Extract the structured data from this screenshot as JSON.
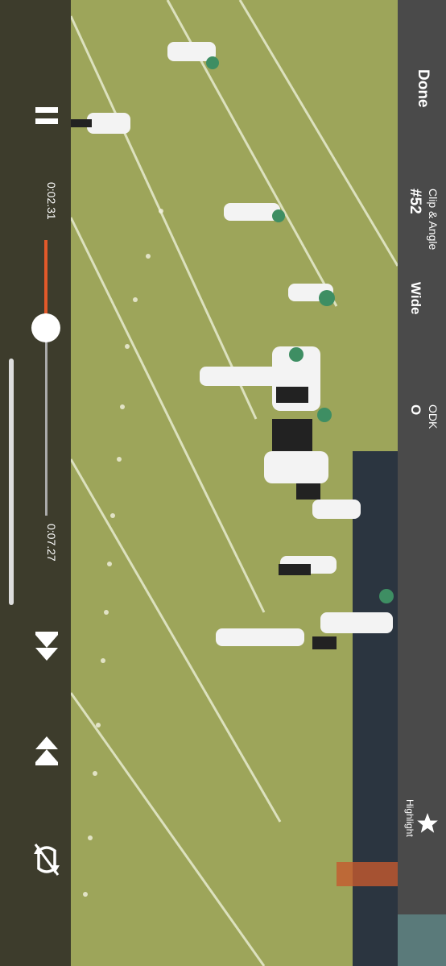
{
  "player": {
    "pause_icon": "pause-icon",
    "current_time": "0:02.31",
    "total_time": "0:07.27",
    "progress_fraction": 0.32,
    "accent_color": "#e2592a",
    "controls": {
      "prev_icon": "skip-to-start-icon",
      "next_icon": "skip-to-end-icon",
      "loop_icon": "loop-off-icon"
    }
  },
  "panel": {
    "done_label": "Done",
    "clip_angle_label": "Clip & Angle",
    "clip_number": "#52",
    "angle_value": "Wide",
    "odk_label": "ODK",
    "odk_value": "O",
    "highlight_label": "Highlight",
    "highlight_icon": "star-icon"
  }
}
